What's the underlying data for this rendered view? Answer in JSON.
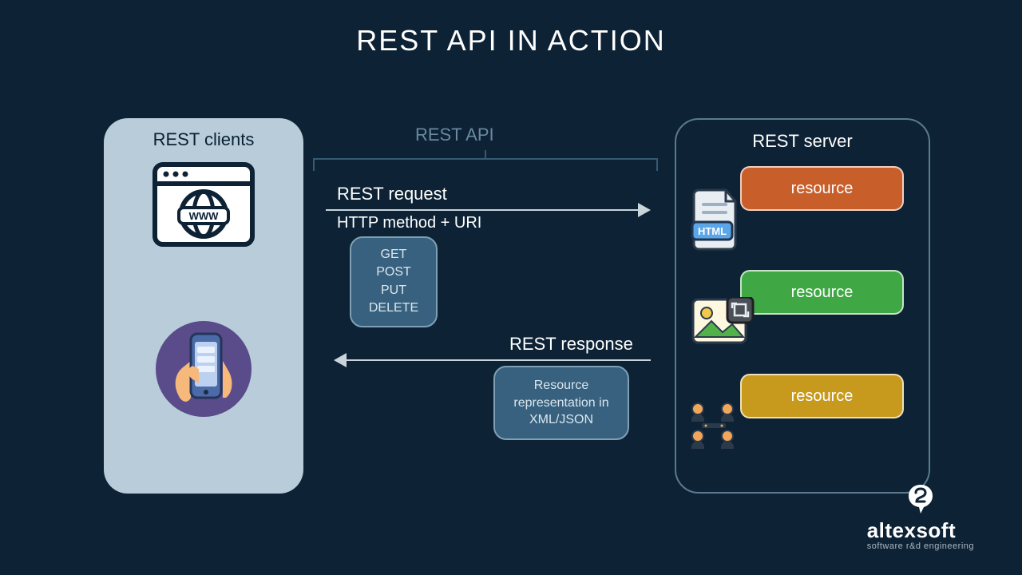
{
  "title": "REST API IN ACTION",
  "clients": {
    "title": "REST clients",
    "browser_text": "WWW"
  },
  "middle": {
    "api_label": "REST API",
    "request_label": "REST request",
    "request_sub": "HTTP method + URI",
    "methods": [
      "GET",
      "POST",
      "PUT",
      "DELETE"
    ],
    "response_label": "REST response",
    "response_box": "Resource representation in XML/JSON"
  },
  "server": {
    "title": "REST server",
    "resources": [
      {
        "label": "resource",
        "color": "orange",
        "icon": "html"
      },
      {
        "label": "resource",
        "color": "green",
        "icon": "image"
      },
      {
        "label": "resource",
        "color": "yellow",
        "icon": "people"
      }
    ],
    "html_badge": "HTML"
  },
  "logo": {
    "name": "altexsoft",
    "tagline": "software r&d engineering"
  }
}
